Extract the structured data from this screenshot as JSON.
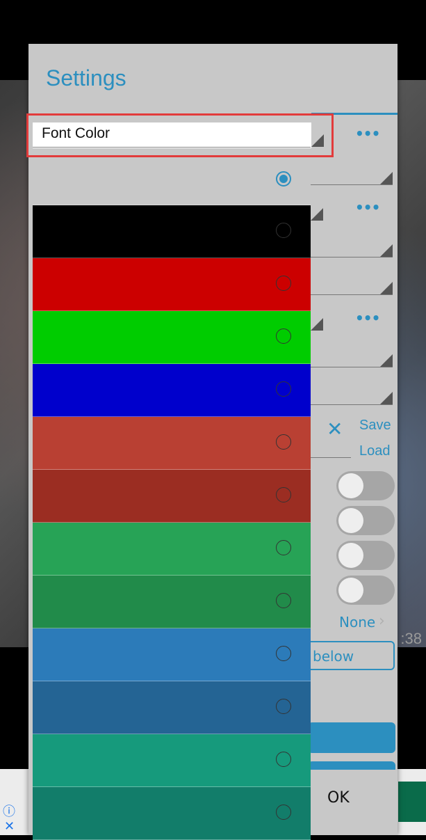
{
  "dialog": {
    "title": "Settings",
    "right_panel": {
      "save_label": "Save",
      "load_label": "Load",
      "none_label": "None",
      "outline_button_label": "below",
      "ok_label": "OK"
    },
    "background_time": ":38"
  },
  "spinner": {
    "selected_label": "Font Color"
  },
  "color_options": [
    {
      "color": "#c8c8c8",
      "selected": true
    },
    {
      "color": "#000000",
      "selected": false
    },
    {
      "color": "#cc0000",
      "selected": false
    },
    {
      "color": "#00cc00",
      "selected": false
    },
    {
      "color": "#0000cc",
      "selected": false
    },
    {
      "color": "#b94033",
      "selected": false
    },
    {
      "color": "#9b2d22",
      "selected": false
    },
    {
      "color": "#27a356",
      "selected": false
    },
    {
      "color": "#218b4a",
      "selected": false
    },
    {
      "color": "#2c7bb9",
      "selected": false
    },
    {
      "color": "#246494",
      "selected": false
    },
    {
      "color": "#169a7c",
      "selected": false
    },
    {
      "color": "#127d6a",
      "selected": false
    }
  ],
  "colors": {
    "accent": "#2c8fbf",
    "highlight_border": "#e23b3b"
  }
}
